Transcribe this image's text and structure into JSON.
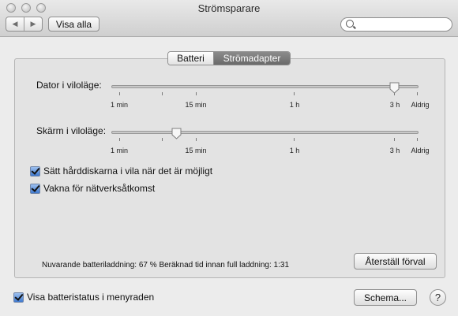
{
  "window": {
    "title": "Strömsparare"
  },
  "toolbar": {
    "show_all_label": "Visa alla",
    "back_icon": "◀",
    "forward_icon": "▶",
    "search_placeholder": ""
  },
  "tabs": [
    {
      "label": "Batteri",
      "selected": false
    },
    {
      "label": "Strömadapter",
      "selected": true
    }
  ],
  "computer_sleep": {
    "label": "Dator i viloläge:",
    "value": "3 h"
  },
  "display_sleep": {
    "label": "Skärm i viloläge:",
    "value": "7 min"
  },
  "slider_ticks": [
    "1 min",
    "15 min",
    "1 h",
    "3 h",
    "Aldrig"
  ],
  "options": [
    {
      "label": "Sätt hårddiskarna i vila när det är möjligt",
      "checked": true
    },
    {
      "label": "Vakna för nätverksåtkomst",
      "checked": true
    }
  ],
  "status": {
    "charge": "Nuvarande batteriladdning: 67 %",
    "time": "Beräknad tid innan full laddning: 1:31"
  },
  "restore_defaults_label": "Återställ förval",
  "menubar_status": {
    "label": "Visa batteristatus i menyraden",
    "checked": true
  },
  "schedule_label": "Schema...",
  "help_label": "?",
  "accent_color": "#3f79cf"
}
